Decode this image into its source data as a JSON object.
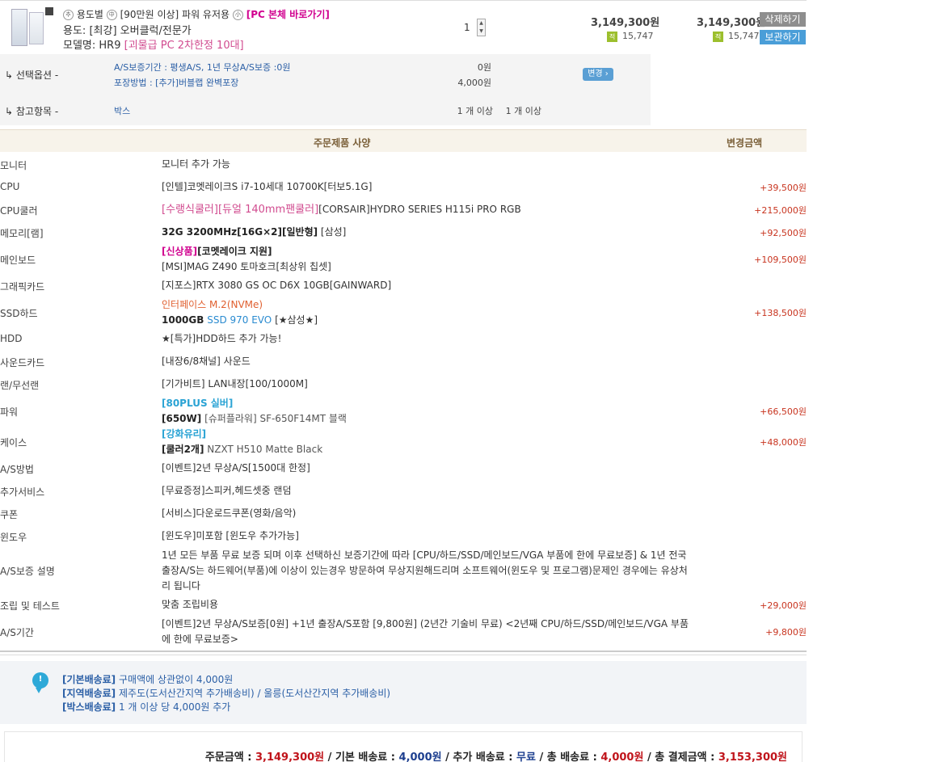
{
  "product": {
    "badge1": "추",
    "line1_prefix": "용도별",
    "badge2": "中",
    "line1_mid": "[90만원 이상] 파워 유저용",
    "badge3": "小",
    "line1_link": "[PC 본체 바로가기]",
    "usage_label": "용도:",
    "usage_value": "[최강] 오버클럭/전문가",
    "model_label": "모델명:",
    "model_code": "HR9",
    "model_desc": "[괴물급 PC 2차한정 10대]",
    "quantity": "1",
    "stepper_up": "▲",
    "stepper_down": "▼",
    "unit_price": "3,149,300원",
    "unit_point": "15,747",
    "total_price": "3,149,300원",
    "total_point": "15,747",
    "point_badge": "적",
    "delete_label": "삭제하기",
    "keep_label": "보관하기"
  },
  "options": {
    "select_label": "↳ 선택옵션 -",
    "select_items": [
      {
        "text": "A/S보증기간 : 평생A/S, 1년 무상A/S보증 :0원",
        "price": "0원"
      },
      {
        "text": "포장방법 : [추가]버블랩 완벽포장",
        "price": "4,000원"
      }
    ],
    "change_label": "변경 ›",
    "ref_label": "↳ 참고항목 -",
    "ref_value": "박스",
    "ref_min1": "1 개 이상",
    "ref_min2": "1 개 이상"
  },
  "spec_header": {
    "spec": "주문제품 사양",
    "amount": "변경금액"
  },
  "specs": [
    {
      "name": "모니터",
      "lines": [
        [
          {
            "t": "모니터 추가 가능"
          }
        ]
      ],
      "amount": ""
    },
    {
      "name": "CPU",
      "lines": [
        [
          {
            "t": "[인텔]코멧레이크S i7-10세대 10700K[터보5.1G]"
          }
        ]
      ],
      "amount": "+39,500원"
    },
    {
      "name": "CPU쿨러",
      "lines": [
        [
          {
            "t": "[수랭식쿨러][듀얼 140mm팬쿨러]",
            "c": "pinkbig"
          },
          {
            "t": "[CORSAIR]HYDRO SERIES H115i PRO RGB"
          }
        ]
      ],
      "amount": "+215,000원"
    },
    {
      "name": "메모리[램]",
      "lines": [
        [
          {
            "t": "32G 3200MHz[16G×2][일반형]",
            "c": "b"
          },
          {
            "t": " [삼성]"
          }
        ]
      ],
      "amount": "+92,500원"
    },
    {
      "name": "메인보드",
      "lines": [
        [
          {
            "t": "[신상품]",
            "c": "pinkbold"
          },
          {
            "t": "[코멧레이크 지원]",
            "c": "b"
          }
        ],
        [
          {
            "t": "[MSI]MAG Z490 토마호크[최상위 칩셋]"
          }
        ]
      ],
      "amount": "+109,500원"
    },
    {
      "name": "그래픽카드",
      "lines": [
        [
          {
            "t": "[지포스]RTX 3080 GS OC D6X 10GB[GAINWARD]"
          }
        ]
      ],
      "amount": ""
    },
    {
      "name": "SSD하드",
      "lines": [
        [
          {
            "t": "인터페이스 M.2(NVMe)",
            "c": "orange"
          }
        ],
        [
          {
            "t": "1000GB",
            "c": "b"
          },
          {
            "t": " SSD 970 EVO",
            "c": "blue"
          },
          {
            "t": " [★삼성★]"
          }
        ]
      ],
      "amount": "+138,500원"
    },
    {
      "name": "HDD",
      "lines": [
        [
          {
            "t": "★[특가]HDD하드 추가 가능!"
          }
        ]
      ],
      "amount": ""
    },
    {
      "name": "사운드카드",
      "lines": [
        [
          {
            "t": "[내장6/8채널] 사운드"
          }
        ]
      ],
      "amount": ""
    },
    {
      "name": "랜/무선랜",
      "lines": [
        [
          {
            "t": "[기가비트] LAN내장[100/1000M]"
          }
        ]
      ],
      "amount": ""
    },
    {
      "name": "파워",
      "lines": [
        [
          {
            "t": "[80PLUS 실버]",
            "c": "cyanbold"
          }
        ],
        [
          {
            "t": "[650W]",
            "c": "b"
          },
          {
            "t": " [슈퍼플라워] SF-650F14MT 블랙",
            "c": "grey"
          }
        ]
      ],
      "amount": "+66,500원"
    },
    {
      "name": "케이스",
      "lines": [
        [
          {
            "t": "[강화유리]",
            "c": "cyanbold"
          }
        ],
        [
          {
            "t": "[쿨러2개]",
            "c": "b"
          },
          {
            "t": " NZXT H510 Matte Black",
            "c": "grey"
          }
        ]
      ],
      "amount": "+48,000원"
    },
    {
      "name": "A/S방법",
      "lines": [
        [
          {
            "t": "[이벤트]2년 무상A/S[1500대 한정]"
          }
        ]
      ],
      "amount": ""
    },
    {
      "name": "추가서비스",
      "lines": [
        [
          {
            "t": "[무료증정]스피커,헤드셋중 랜덤"
          }
        ]
      ],
      "amount": ""
    },
    {
      "name": "쿠폰",
      "lines": [
        [
          {
            "t": "[서비스]다운로드쿠폰(영화/음악)"
          }
        ]
      ],
      "amount": ""
    },
    {
      "name": "윈도우",
      "lines": [
        [
          {
            "t": "[윈도우]미포함 [윈도우 추가가능]"
          }
        ]
      ],
      "amount": ""
    },
    {
      "name": "A/S보증 설명",
      "lines": [
        [
          {
            "t": "1년 모든 부품 무료 보증 되며 이후 선택하신 보증기간에 따라 [CPU/하드/SSD/메인보드/VGA 부품에 한에 무료보증] & 1년 전국 출장A/S는 하드웨어(부품)에 이상이 있는경우 방문하여 무상지원해드리며 소프트웨어(윈도우 및 프로그램)문제인 경우에는 유상처리 됩니다"
          }
        ]
      ],
      "amount": ""
    },
    {
      "name": "조립 및 테스트",
      "lines": [
        [
          {
            "t": "맞춤 조립비용"
          }
        ]
      ],
      "amount": "+29,000원"
    },
    {
      "name": "A/S기간",
      "lines": [
        [
          {
            "t": "[이벤트]2년 무상A/S보증[0원] +1년 출장A/S포함 [9,800원] (2년간 기술비 무료) <2년째 CPU/하드/SSD/메인보드/VGA 부품에 한에 무료보증>"
          }
        ]
      ],
      "amount": "+9,800원"
    }
  ],
  "shipping": {
    "icon_glyph": "!",
    "lines": [
      {
        "tag": "[기본배송료]",
        "text": " 구매액에 상관없이 4,000원"
      },
      {
        "tag": "[지역배송료]",
        "text": " 제주도(도서산간지역 추가배송비) / 울릉(도서산간지역 추가배송비)"
      },
      {
        "tag": "[박스배송료]",
        "text": " 1 개 이상 당 4,000원 추가"
      }
    ]
  },
  "totals": {
    "order_label": "주문금액 : ",
    "order_value": "3,149,300원",
    "base_label": " / 기본 배송료 : ",
    "base_value": "4,000원",
    "extra_label": " / 추가 배송료 : ",
    "extra_value": "무료",
    "ship_label": " / 총 배송료 : ",
    "ship_value": "4,000원",
    "pay_label": " / 총 결제금액 : ",
    "pay_value": "3,153,300원"
  }
}
